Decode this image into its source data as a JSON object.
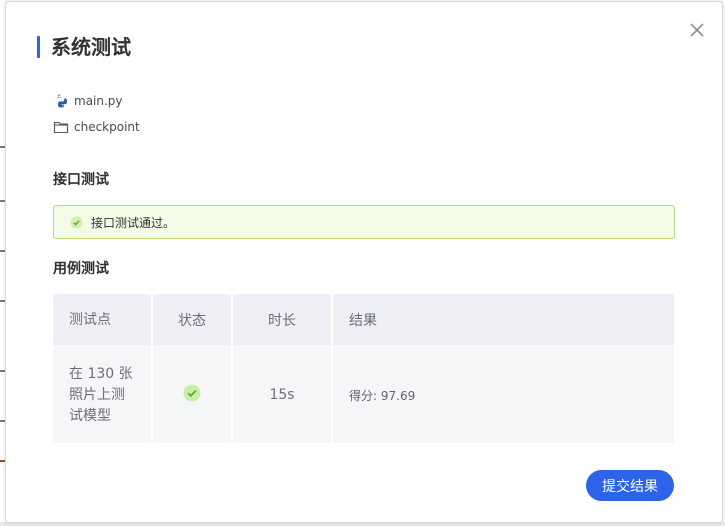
{
  "dialog": {
    "title": "系统测试",
    "close_icon": "close-icon"
  },
  "files": [
    {
      "name": "main.py",
      "icon": "python-icon"
    },
    {
      "name": "checkpoint",
      "icon": "folder-icon"
    }
  ],
  "interface_test": {
    "heading": "接口测试",
    "message": "接口测试通过。",
    "icon": "check-circle-icon"
  },
  "case_test": {
    "heading": "用例测试",
    "columns": [
      "测试点",
      "状态",
      "时长",
      "结果"
    ],
    "rows": [
      {
        "point": "在 130 张照片上测试模型",
        "status_icon": "check-circle-icon",
        "duration": "15s",
        "result": "得分: 97.69"
      }
    ]
  },
  "submit_label": "提交结果",
  "colors": {
    "accent": "#2d63e8",
    "success_bg": "#f4fbe6",
    "success_border": "#b5dc73",
    "success_icon": "#8ccf3f"
  }
}
